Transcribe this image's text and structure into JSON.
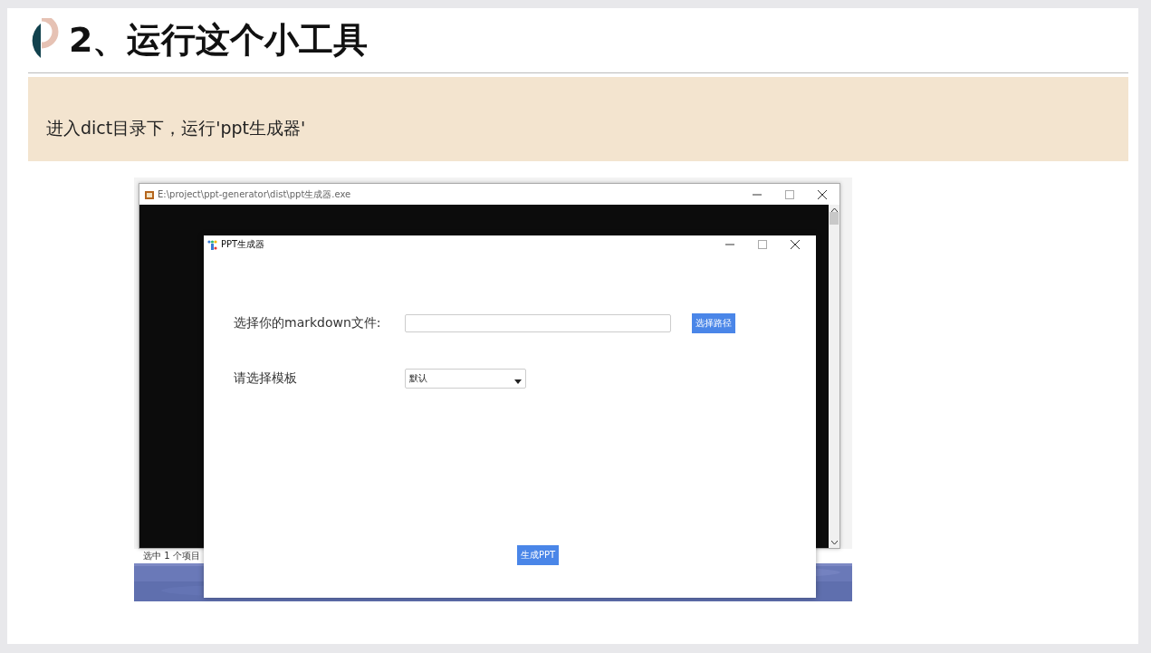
{
  "slide": {
    "title": "2、运行这个小工具",
    "note": "进入dict目录下，运行'ppt生成器'"
  },
  "screenshot": {
    "console_window": {
      "title": "E:\\project\\ppt-generator\\dist\\ppt生成器.exe"
    },
    "status_text": "选中 1 个项目",
    "dialog": {
      "title": "PPT生成器",
      "file_label": "选择你的markdown文件:",
      "browse_button": "选择路径",
      "template_label": "请选择模板",
      "template_select": {
        "value": "默认"
      },
      "generate_button": "生成PPT"
    }
  }
}
